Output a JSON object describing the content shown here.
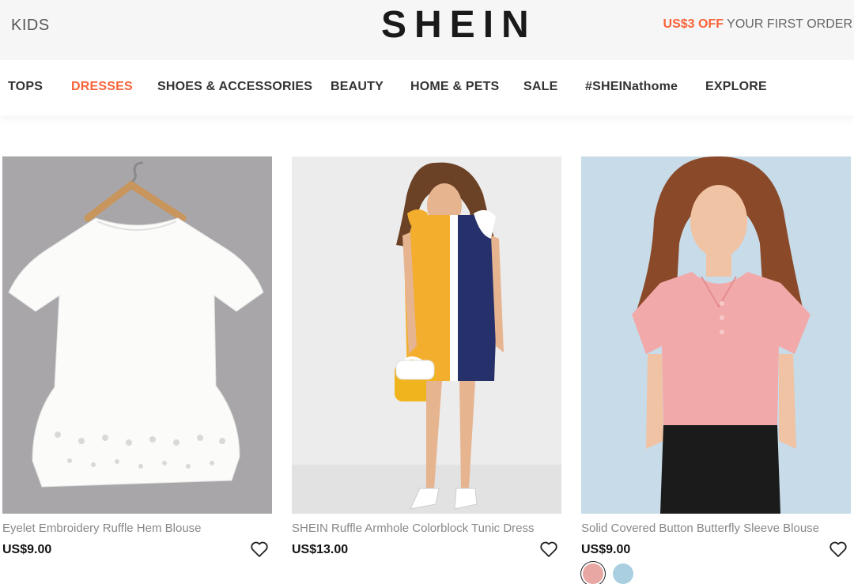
{
  "header": {
    "kids_label": "KIDS",
    "logo_text": "SHEIN",
    "promo_highlight": "US$3 OFF",
    "promo_text": " YOUR FIRST ORDER"
  },
  "nav": {
    "items": [
      {
        "label": "TOPS"
      },
      {
        "label": "DRESSES",
        "active": true
      },
      {
        "label": "SHOES & ACCESSORIES"
      },
      {
        "label": "BEAUTY"
      },
      {
        "label": "HOME & PETS"
      },
      {
        "label": "SALE"
      },
      {
        "label": "#SHEINathome"
      },
      {
        "label": "EXPLORE"
      }
    ]
  },
  "products": [
    {
      "title": "Eyelet Embroidery Ruffle Hem Blouse",
      "price": "US$9.00",
      "icon": "heart-icon"
    },
    {
      "title": "SHEIN Ruffle Armhole Colorblock Tunic Dress",
      "price": "US$13.00",
      "icon": "heart-icon"
    },
    {
      "title": "Solid Covered Button Butterfly Sleeve Blouse",
      "price": "US$9.00",
      "icon": "heart-icon",
      "swatches": [
        "#e8a7a2",
        "#a9cfe0"
      ]
    }
  ],
  "colors": {
    "accent": "#fa6338",
    "topbar_bg": "#f6f6f6"
  }
}
